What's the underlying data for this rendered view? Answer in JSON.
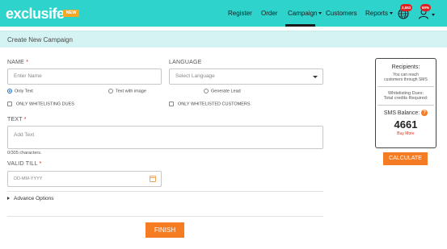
{
  "header": {
    "logo": "exclusife",
    "new_badge": "NEW",
    "nav": [
      "Register",
      "Order",
      "Campaign",
      "Customers",
      "Reports"
    ],
    "globe_badge": "2,653",
    "user_badge": "50%",
    "accent": "#2ed3cc"
  },
  "page": {
    "title": "Create New Campaign"
  },
  "form": {
    "name_label": "NAME",
    "required_mark": "*",
    "name_placeholder": "Enter Name",
    "language_label": "LANGUAGE",
    "language_placeholder": "Select Language",
    "radio_only_text": "Only Text",
    "radio_text_image": "Text with image",
    "radio_generate_lead": "Generate Lead",
    "chk_whitelisting_dues": "ONLY WHITELISTING DUES",
    "chk_whitelisted_customers": "ONLY WHITELISTED CUSTOMERS",
    "text_label": "TEXT",
    "text_placeholder": "Add Text",
    "char_count": "0/305 characters.",
    "valid_till_label": "VALID TILL",
    "valid_till_placeholder": "DD-MM-YYYY",
    "advanced_options": "Advance Options",
    "finish": "FINISH"
  },
  "sidebar": {
    "recipients_title": "Recipients:",
    "recipients_desc_1": "You can reach",
    "recipients_desc_2": "customers through SMS",
    "whitelisting_1": "Whitelisting Dues:",
    "whitelisting_2": "Total credits Required:",
    "sms_balance_label": "SMS Balance:",
    "help_glyph": "?",
    "sms_balance_value": "4661",
    "buy_more": "Buy More",
    "calculate": "CALCULATE"
  }
}
